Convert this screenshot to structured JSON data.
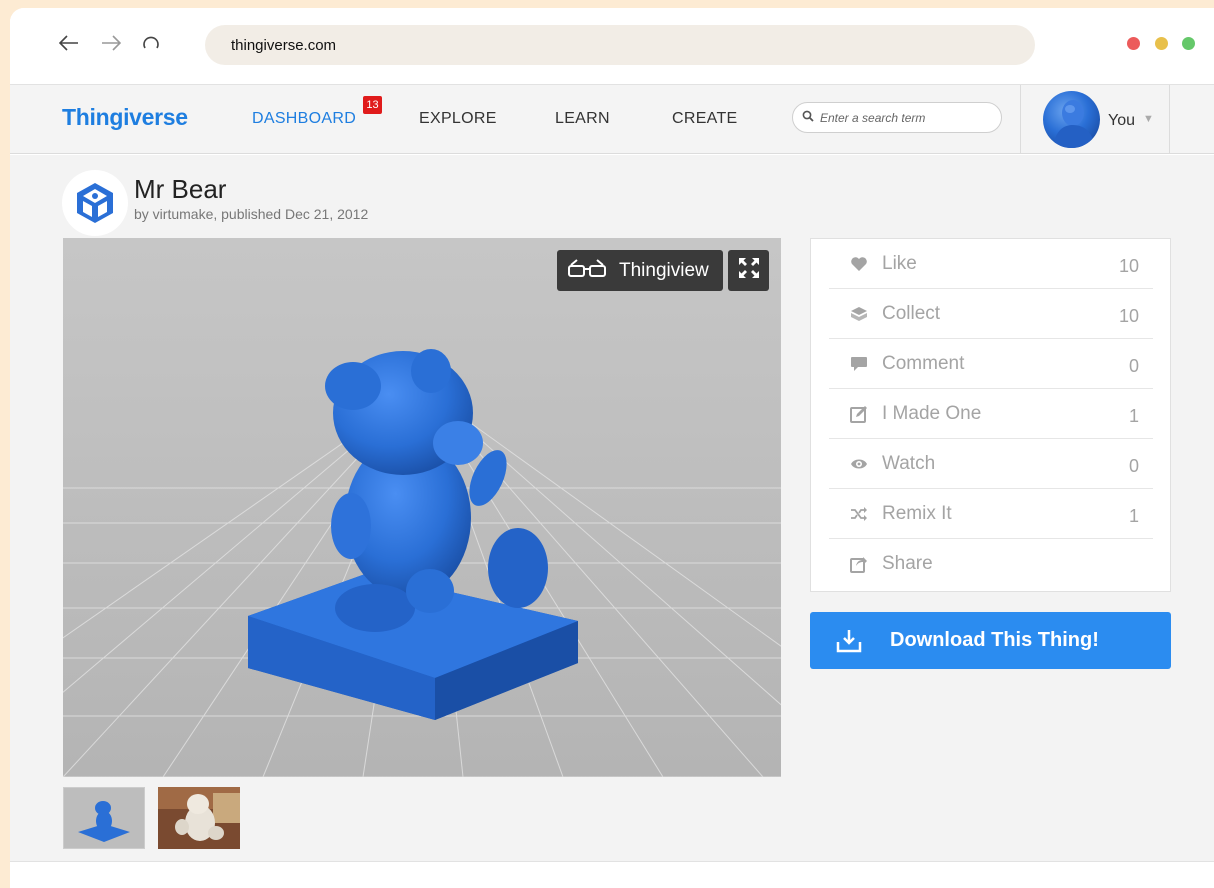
{
  "browser": {
    "url": "thingiverse.com",
    "traffic_lights": [
      "#ec5b5b",
      "#e8c04b",
      "#65c86a"
    ]
  },
  "header": {
    "logo": "Thingiverse",
    "nav": [
      {
        "label": "DASHBOARD",
        "badge": "13",
        "active": true
      },
      {
        "label": "EXPLORE"
      },
      {
        "label": "LEARN"
      },
      {
        "label": "CREATE"
      }
    ],
    "search_placeholder": "Enter a search term",
    "user": {
      "name": "You"
    }
  },
  "thing": {
    "title": "Mr Bear",
    "byline": "by virtumake, published Dec 21, 2012"
  },
  "viewer": {
    "thingiview_label": "Thingiview",
    "thumbnails": [
      "model-render",
      "photo"
    ]
  },
  "actions": [
    {
      "label": "Like",
      "count": "10",
      "icon": "heart-icon"
    },
    {
      "label": "Collect",
      "count": "10",
      "icon": "collect-icon"
    },
    {
      "label": "Comment",
      "count": "0",
      "icon": "comment-icon"
    },
    {
      "label": "I Made One",
      "count": "1",
      "icon": "edit-icon"
    },
    {
      "label": "Watch",
      "count": "0",
      "icon": "eye-icon"
    },
    {
      "label": "Remix It",
      "count": "1",
      "icon": "shuffle-icon"
    },
    {
      "label": "Share",
      "count": "",
      "icon": "share-icon"
    }
  ],
  "download": {
    "label": "Download This Thing!"
  },
  "colors": {
    "brand_blue": "#1e7ee0",
    "download_blue": "#2b8cf0",
    "model_blue": "#2a6fd6",
    "badge_red": "#e01b1b"
  }
}
